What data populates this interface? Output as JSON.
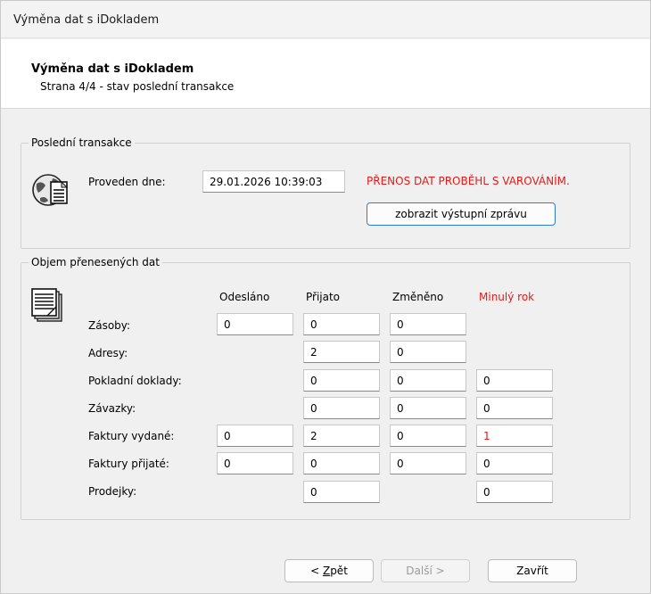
{
  "window": {
    "title": "Výměna dat s iDokladem"
  },
  "header": {
    "title": "Výměna dat s iDokladem",
    "subtitle": "Strana 4/4 - stav poslední transakce"
  },
  "last_transaction": {
    "group_label": "Poslední transakce",
    "date_label": "Proveden dne:",
    "date_value": "29.01.2026 10:39:03",
    "status": "PŘENOS DAT PROBĚHL S VAROVÁNÍM.",
    "show_output_button": "zobrazit výstupní zprávu"
  },
  "volume": {
    "group_label": "Objem přenesených dat",
    "columns": [
      "Odesláno",
      "Přijato",
      "Změněno",
      "Minulý rok"
    ],
    "rows": [
      {
        "label": "Zásoby:",
        "odeslano": "0",
        "prijato": "0",
        "zmeneno": "0",
        "minuly_rok": ""
      },
      {
        "label": "Adresy:",
        "odeslano": "",
        "prijato": "2",
        "zmeneno": "0",
        "minuly_rok": ""
      },
      {
        "label": "Pokladní doklady:",
        "odeslano": "",
        "prijato": "0",
        "zmeneno": "0",
        "minuly_rok": "0"
      },
      {
        "label": "Závazky:",
        "odeslano": "",
        "prijato": "0",
        "zmeneno": "0",
        "minuly_rok": "0"
      },
      {
        "label": "Faktury vydané:",
        "odeslano": "0",
        "prijato": "2",
        "zmeneno": "0",
        "minuly_rok": "1"
      },
      {
        "label": "Faktury přijaté:",
        "odeslano": "0",
        "prijato": "0",
        "zmeneno": "0",
        "minuly_rok": "0"
      },
      {
        "label": "Prodejky:",
        "odeslano": "",
        "prijato": "0",
        "zmeneno": "",
        "minuly_rok": "0"
      }
    ]
  },
  "footer": {
    "back_prefix": "< ",
    "back_accel": "Z",
    "back_rest": "pět",
    "next": "Další >",
    "close": "Zavřít"
  },
  "colors": {
    "warning": "#e01b1b",
    "accent": "#2c7bd6"
  }
}
